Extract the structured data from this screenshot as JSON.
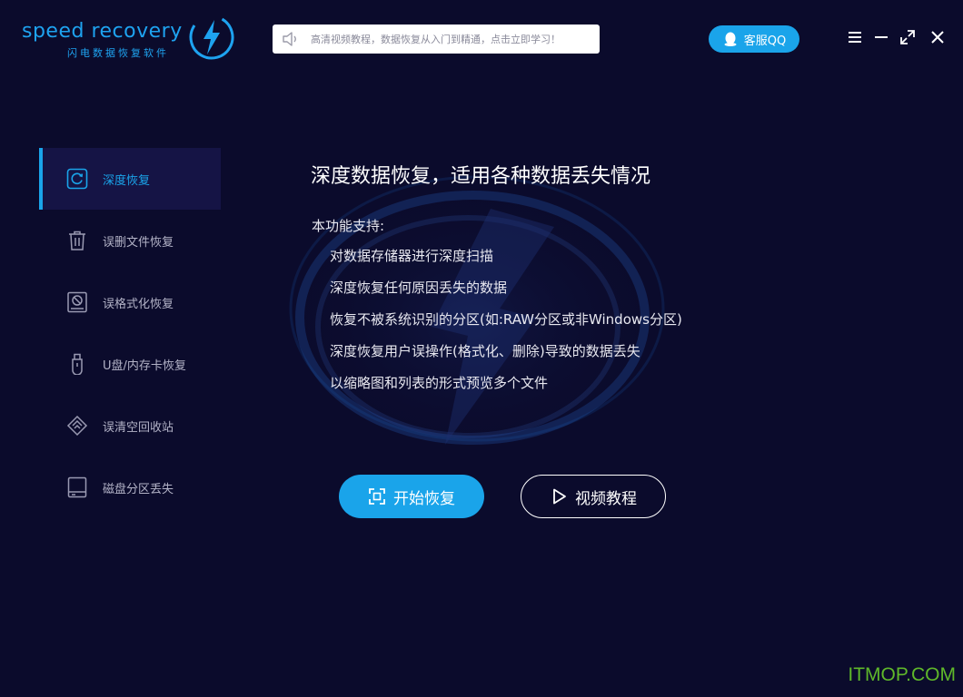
{
  "logo": {
    "text": "speed recovery",
    "subtitle": "闪电数据恢复软件",
    "brand_color": "#1ea3f0"
  },
  "notice": {
    "icon": "speaker-icon",
    "text": "高清视频教程，数据恢复从入门到精通，点击立即学习！"
  },
  "header": {
    "qq_label": "客服QQ",
    "controls": [
      "menu-icon",
      "minimize-icon",
      "maximize-icon",
      "close-icon"
    ]
  },
  "sidebar": {
    "items": [
      {
        "label": "深度恢复",
        "icon": "deep-recovery-icon",
        "active": true
      },
      {
        "label": "误删文件恢复",
        "icon": "trash-icon",
        "active": false
      },
      {
        "label": "误格式化恢复",
        "icon": "format-disk-icon",
        "active": false
      },
      {
        "label": "U盘/内存卡恢复",
        "icon": "usb-icon",
        "active": false
      },
      {
        "label": "误清空回收站",
        "icon": "recycle-bin-icon",
        "active": false
      },
      {
        "label": "磁盘分区丢失",
        "icon": "disk-partition-icon",
        "active": false
      }
    ]
  },
  "main": {
    "title": "深度数据恢复，适用各种数据丢失情况",
    "support_label": "本功能支持:",
    "features": [
      "对数据存储器进行深度扫描",
      "深度恢复任何原因丢失的数据",
      "恢复不被系统识别的分区(如:RAW分区或非Windows分区)",
      "深度恢复用户误操作(格式化、删除)导致的数据丢失",
      "以缩略图和列表的形式预览多个文件"
    ],
    "start_label": "开始恢复",
    "video_label": "视频教程"
  },
  "watermark": "ITMOP.COM",
  "colors": {
    "background": "#0b0b2c",
    "accent": "#1aa4ea",
    "active_bg": "#151445",
    "sidebar_text": "#b3b3c7",
    "watermark": "#5fb82a"
  }
}
